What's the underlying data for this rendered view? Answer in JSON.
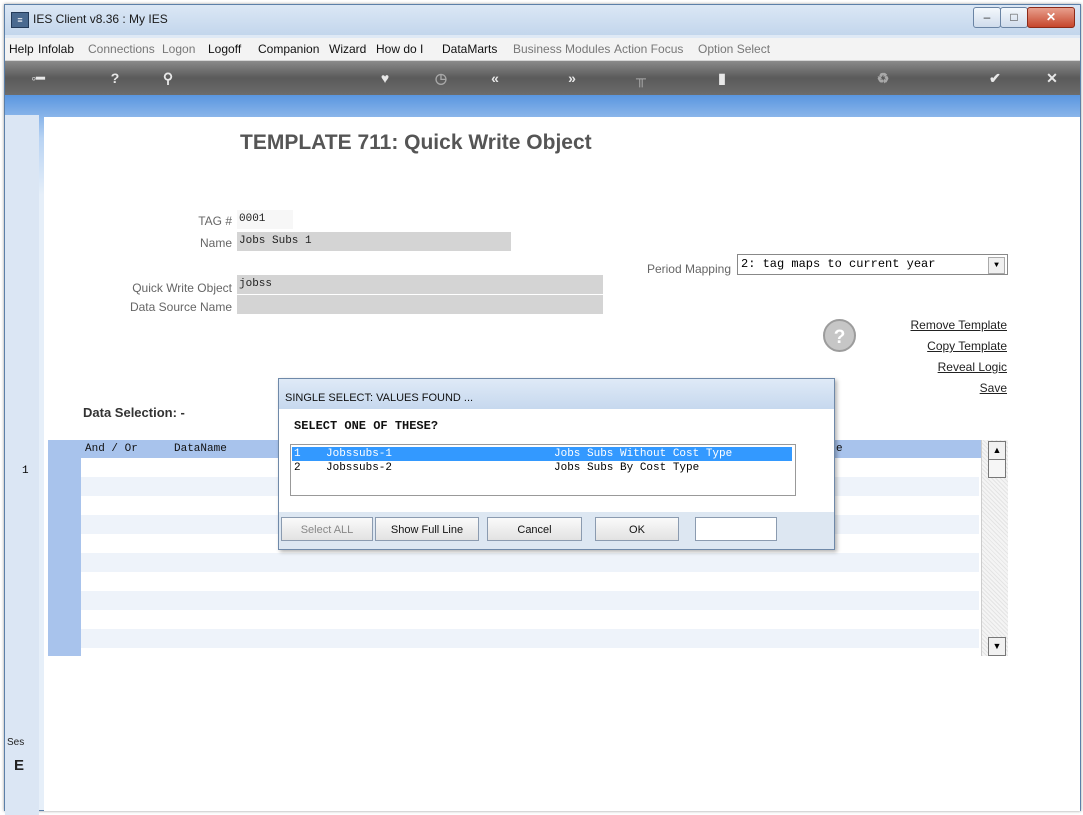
{
  "window": {
    "title": "IES Client v8.36 : My IES",
    "minimize": "–",
    "maximize": "□",
    "close": "✕"
  },
  "menu": {
    "items": [
      "Help",
      "Infolab",
      "Connections",
      "Logon",
      "Logoff",
      "Companion",
      "Wizard",
      "How do I",
      "DataMarts",
      "Business Modules",
      "Action Focus",
      "Option Select"
    ]
  },
  "toolbar": {
    "icons": [
      "key-icon",
      "help-icon",
      "search-icon",
      "heart-icon",
      "clock-icon",
      "back-icon",
      "forward-icon",
      "tools-icon",
      "window-icon",
      "recycle-icon",
      "check-icon",
      "close-icon"
    ]
  },
  "page": {
    "title": "TEMPLATE 711: Quick Write Object"
  },
  "form": {
    "tag_label": "TAG #",
    "tag_value": "0001",
    "name_label": "Name",
    "name_value": "Jobs Subs 1",
    "qwo_label": "Quick Write Object",
    "qwo_value": "jobss",
    "dsn_label": "Data Source Name",
    "dsn_value": "",
    "period_label": "Period Mapping",
    "period_value": "2: tag maps to current year"
  },
  "actions": {
    "remove": "Remove Template",
    "copy": "Copy Template",
    "reveal": "Reveal Logic",
    "save": "Save",
    "help": "?"
  },
  "data_selection": {
    "label": "Data Selection: -",
    "col_and_or": "And / Or",
    "col_dataname": "DataName",
    "col_partial": "e",
    "row_number": "1"
  },
  "dialog": {
    "title": "SINGLE SELECT: VALUES FOUND ...",
    "prompt": "SELECT ONE OF THESE?",
    "options": [
      {
        "num": "1",
        "code": "Jobssubs-1",
        "desc": "Jobs Subs Without Cost Type"
      },
      {
        "num": "2",
        "code": "Jobssubs-2",
        "desc": "Jobs Subs By Cost Type"
      }
    ],
    "buttons": {
      "select_all": "Select ALL",
      "show_full": "Show Full Line",
      "cancel": "Cancel",
      "ok": "OK"
    }
  },
  "sidebar": {
    "ses_label": "Ses",
    "ses_icon": "E"
  }
}
